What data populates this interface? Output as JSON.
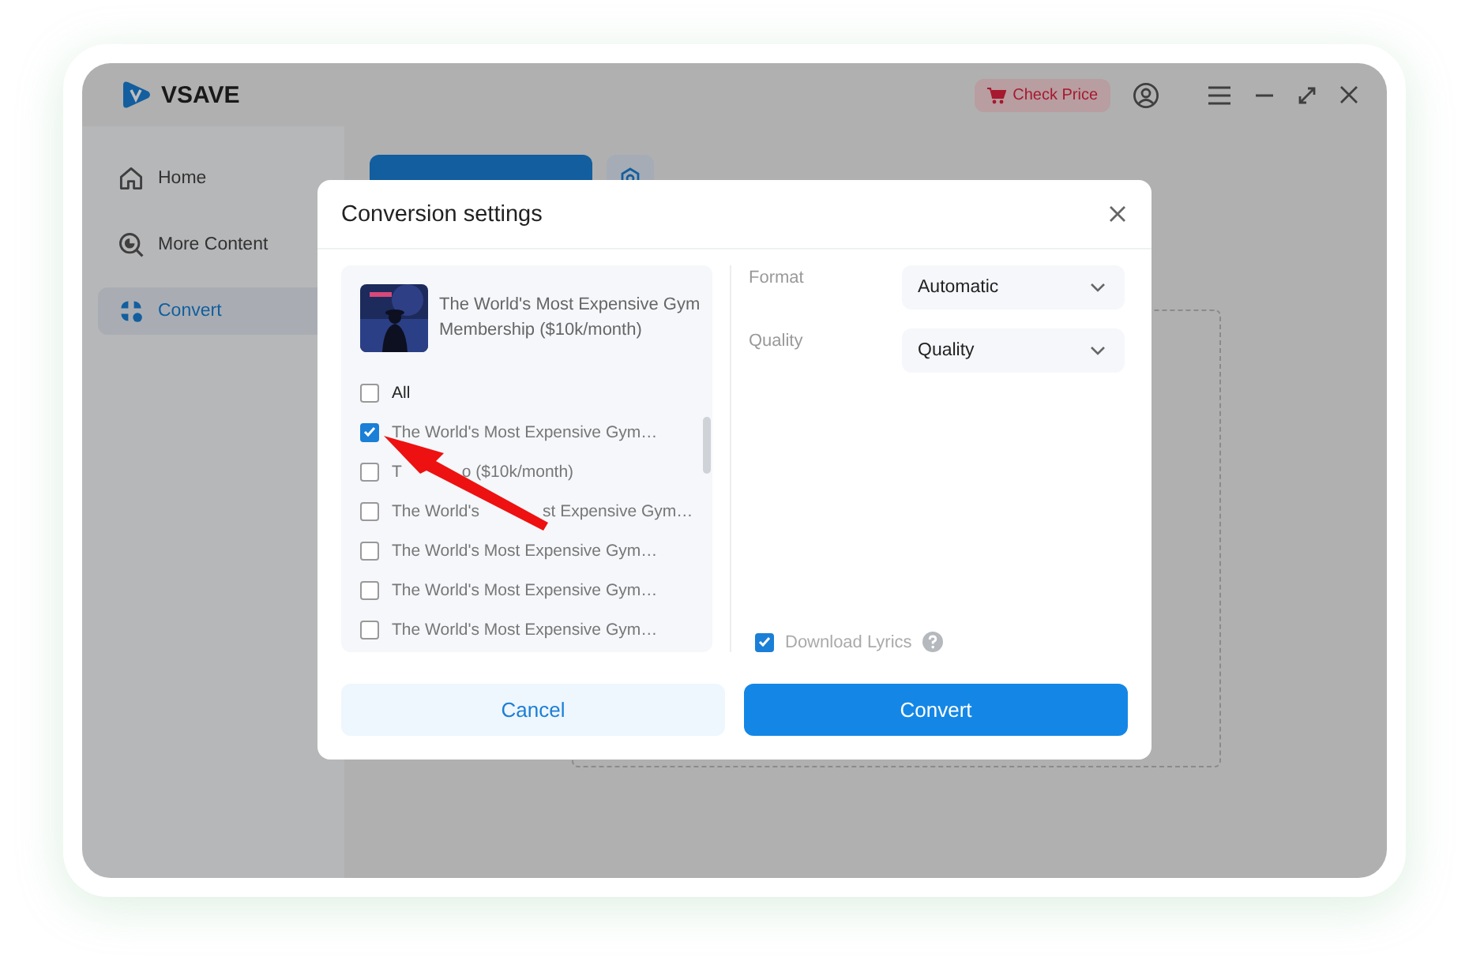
{
  "app": {
    "brand": "VSAVE",
    "check_price": "Check Price"
  },
  "sidebar": {
    "items": [
      {
        "label": "Home",
        "selected": false
      },
      {
        "label": "More Content",
        "selected": false
      },
      {
        "label": "Convert",
        "selected": true
      }
    ]
  },
  "dialog": {
    "title": "Conversion settings",
    "album": {
      "title": "The World's Most Expensive Gym Membership ($10k/month)"
    },
    "all": {
      "label": "All",
      "checked": false
    },
    "tracks": [
      {
        "label": "The World's Most Expensive Gym…",
        "checked": true
      },
      {
        "label": "T",
        "label_tail": "o ($10k/month)",
        "checked": false
      },
      {
        "label": "The World's",
        "label_tail": "st Expensive Gym…",
        "checked": false
      },
      {
        "label": "The World's Most Expensive Gym…",
        "checked": false
      },
      {
        "label": "The World's Most Expensive Gym…",
        "checked": false
      },
      {
        "label": "The World's Most Expensive Gym…",
        "checked": false
      }
    ],
    "settings": [
      {
        "label": "Format",
        "value": "Automatic"
      },
      {
        "label": "Quality",
        "value": "Quality"
      }
    ],
    "lyrics": {
      "label": "Download Lyrics",
      "checked": true
    },
    "buttons": {
      "cancel": "Cancel",
      "confirm": "Convert"
    }
  }
}
